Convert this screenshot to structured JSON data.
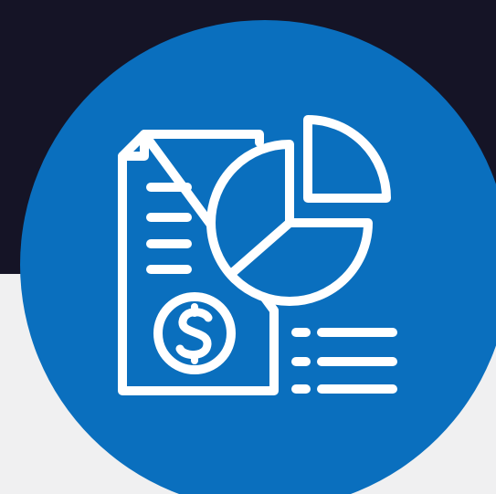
{
  "icon": {
    "name": "financial-report-icon",
    "parts": [
      "document-icon",
      "pie-chart-icon",
      "dollar-coin-icon",
      "legend-list-icon"
    ]
  },
  "colors": {
    "background_top": "#151426",
    "background_bottom": "#f0f0f1",
    "badge": "#0a6fbe",
    "icon_stroke": "#ffffff"
  }
}
